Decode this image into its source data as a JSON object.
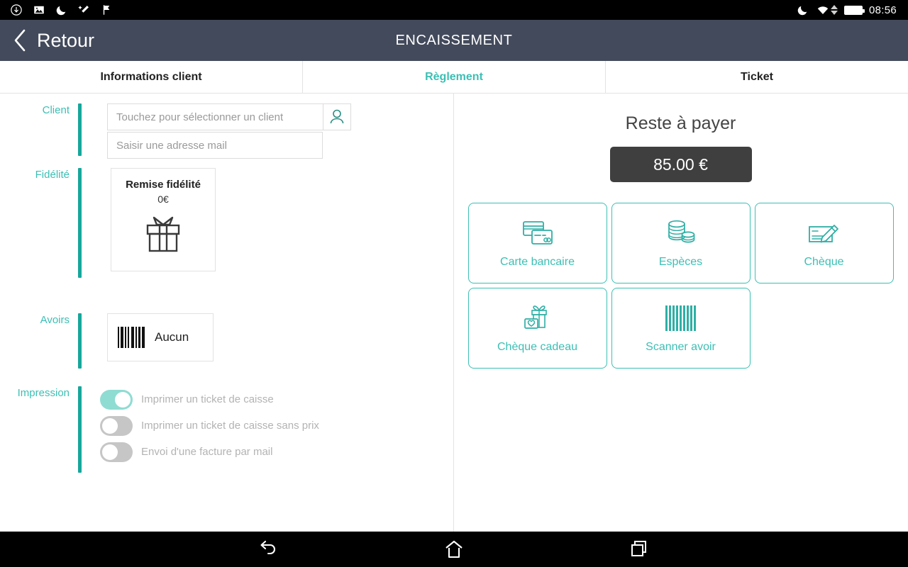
{
  "statusbar": {
    "clock": "08:56",
    "left_icons": [
      "download-icon",
      "image-icon",
      "moon-icon",
      "magic-wand-icon",
      "flag-icon"
    ],
    "right_icons": [
      "moon-icon",
      "wifi-icon",
      "data-arrows-icon",
      "battery-icon"
    ]
  },
  "titlebar": {
    "back_label": "Retour",
    "title": "ENCAISSEMENT",
    "bg": "#434A5B"
  },
  "tabs": [
    {
      "label": "Informations client",
      "active": true
    },
    {
      "label": "Règlement",
      "active": false
    },
    {
      "label": "Ticket",
      "active": false
    }
  ],
  "left": {
    "client": {
      "label": "Client",
      "select_placeholder": "Touchez pour sélectionner un client",
      "select_value": "",
      "mail_placeholder": "Saisir une adresse mail",
      "mail_value": "",
      "picker_icon": "person-icon"
    },
    "fidelite": {
      "label": "Fidélité",
      "card_title": "Remise fidélité",
      "card_amount": "0€",
      "icon": "gift-icon"
    },
    "avoirs": {
      "label": "Avoirs",
      "card_label": "Aucun",
      "icon": "barcode-icon"
    },
    "impression": {
      "label": "Impression",
      "toggles": [
        {
          "label": "Imprimer un ticket de caisse",
          "on": true
        },
        {
          "label": "Imprimer un ticket de caisse sans prix",
          "on": false
        },
        {
          "label": "Envoi d'une facture par mail",
          "on": false
        }
      ]
    }
  },
  "right": {
    "reste_title": "Reste à payer",
    "reste_amount": "85.00 €",
    "payments": [
      {
        "label": "Carte bancaire",
        "icon": "credit-card-icon"
      },
      {
        "label": "Espèces",
        "icon": "coins-icon"
      },
      {
        "label": "Chèque",
        "icon": "cheque-pen-icon"
      },
      {
        "label": "Chèque cadeau",
        "icon": "gift-card-icon"
      },
      {
        "label": "Scanner avoir",
        "icon": "barcode-scan-icon"
      }
    ]
  },
  "navbar": {
    "items": [
      "back-nav-icon",
      "home-nav-icon",
      "recents-nav-icon"
    ]
  },
  "colors": {
    "accent_teal": "#3CBFB4",
    "bar_teal": "#16A79B",
    "header_slate": "#434A5B",
    "amount_dark": "#3F3F3F"
  }
}
